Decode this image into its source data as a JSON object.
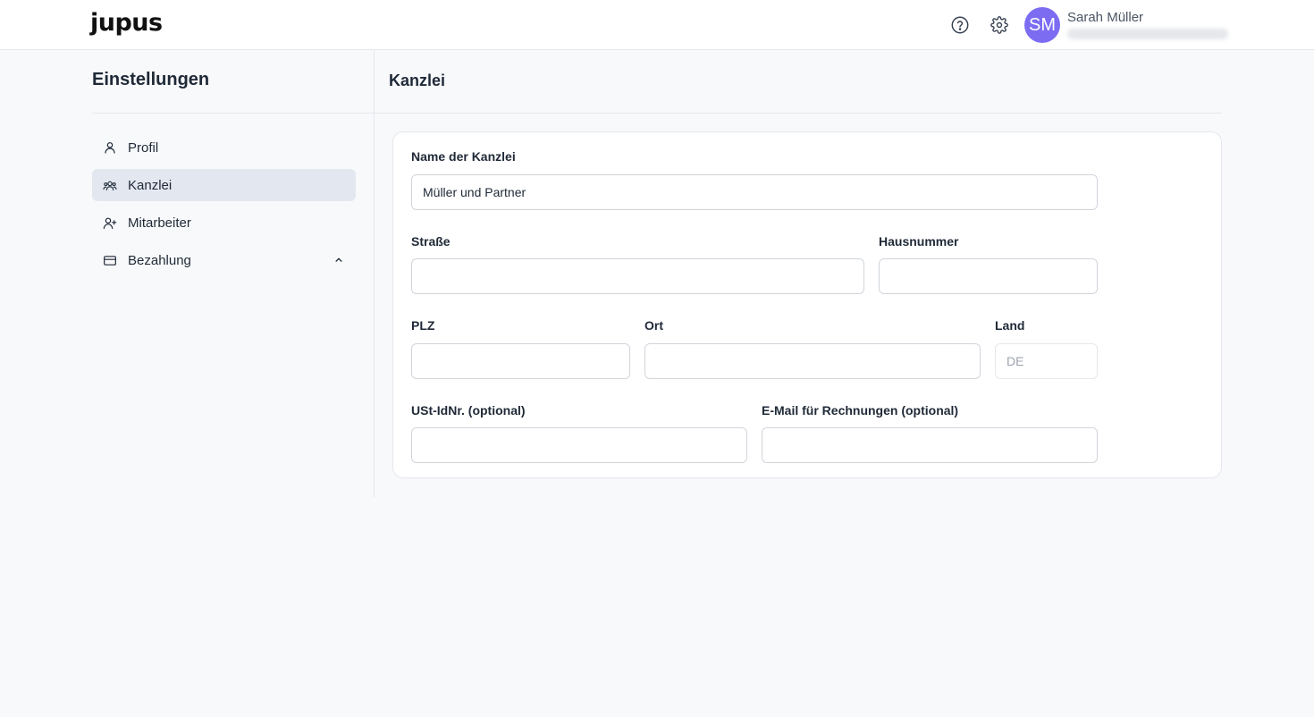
{
  "header": {
    "logo": "jupus",
    "user": {
      "initials": "SM",
      "name": "Sarah Müller"
    }
  },
  "sidebar": {
    "title": "Einstellungen",
    "items": [
      {
        "label": "Profil"
      },
      {
        "label": "Kanzlei"
      },
      {
        "label": "Mitarbeiter"
      },
      {
        "label": "Bezahlung"
      }
    ]
  },
  "main": {
    "title": "Kanzlei",
    "form": {
      "name": {
        "label": "Name der Kanzlei",
        "value": "Müller und Partner"
      },
      "street": {
        "label": "Straße",
        "value": ""
      },
      "house_number": {
        "label": "Hausnummer",
        "value": ""
      },
      "zip": {
        "label": "PLZ",
        "value": ""
      },
      "city": {
        "label": "Ort",
        "value": ""
      },
      "country": {
        "label": "Land",
        "value": "DE"
      },
      "vat_id": {
        "label": "USt-IdNr. (optional)",
        "value": ""
      },
      "invoice_email": {
        "label": "E-Mail für Rechnungen (optional)",
        "value": ""
      }
    }
  },
  "colors": {
    "avatar": "#7c6cf2",
    "active_nav": "#e3e8f0",
    "background": "#f8f9fb"
  }
}
